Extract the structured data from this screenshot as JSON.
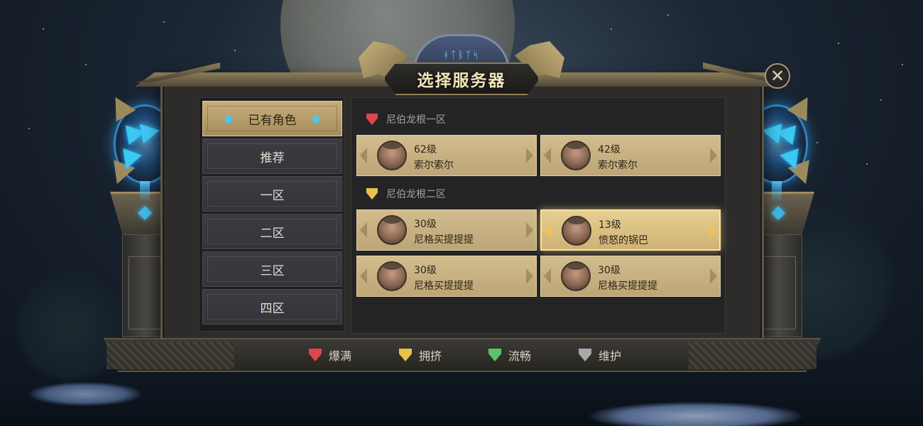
{
  "title": "选择服务器",
  "emblem_text": "ᚼᛏᛒᛉᛋ",
  "colors": {
    "full": "#e0464b",
    "crowded": "#e9c24b",
    "smooth": "#5bc16a",
    "maintenance": "#a9a9a9",
    "tab_active": "#c6ae7c",
    "tab_inactive": "#3a3b41",
    "card": "#c9b383"
  },
  "tabs": [
    {
      "label": "已有角色",
      "active": true
    },
    {
      "label": "推荐",
      "active": false
    },
    {
      "label": "一区",
      "active": false
    },
    {
      "label": "二区",
      "active": false
    },
    {
      "label": "三区",
      "active": false
    },
    {
      "label": "四区",
      "active": false
    }
  ],
  "groups": [
    {
      "name": "尼伯龙根一区",
      "status": "full",
      "characters": [
        {
          "level": "62级",
          "name": "索尔索尔",
          "selected": false
        },
        {
          "level": "42级",
          "name": "索尔索尔",
          "selected": false
        }
      ]
    },
    {
      "name": "尼伯龙根二区",
      "status": "crowded",
      "characters": [
        {
          "level": "30级",
          "name": "尼格买提提提",
          "selected": false
        },
        {
          "level": "13级",
          "name": "愤怒的锅巴",
          "selected": true
        },
        {
          "level": "30级",
          "name": "尼格买提提提",
          "selected": false
        },
        {
          "level": "30级",
          "name": "尼格买提提提",
          "selected": false
        }
      ]
    }
  ],
  "legend": [
    {
      "label": "爆满",
      "status": "full"
    },
    {
      "label": "拥挤",
      "status": "crowded"
    },
    {
      "label": "流畅",
      "status": "smooth"
    },
    {
      "label": "维护",
      "status": "maintenance"
    }
  ],
  "icons": {
    "close": "close-icon",
    "status_shield": "shield-icon",
    "avatar": "avatar-portrait"
  }
}
